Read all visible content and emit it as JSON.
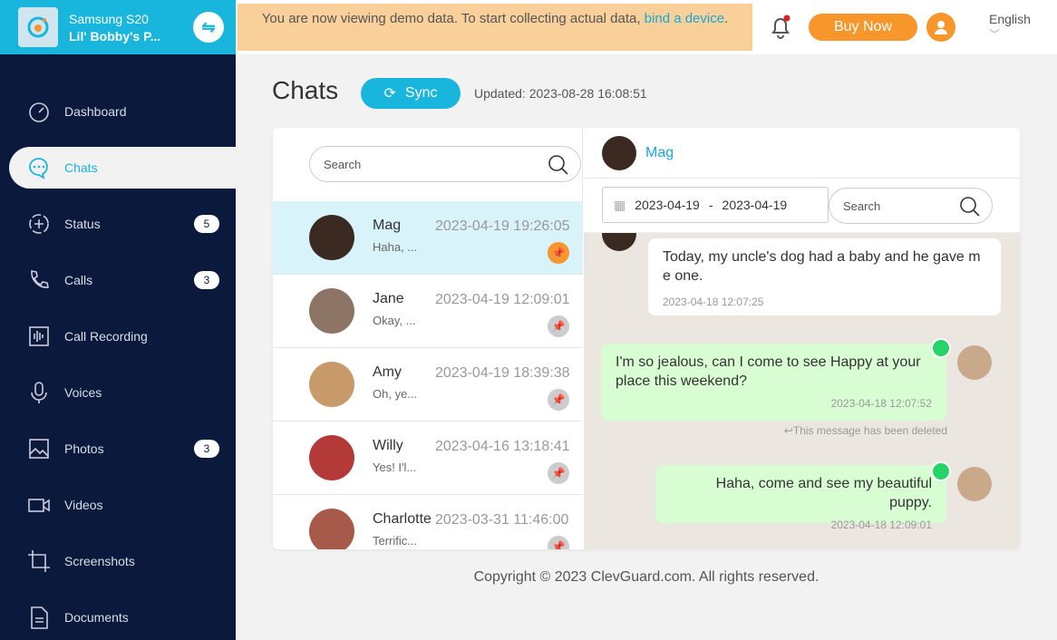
{
  "device": {
    "model": "Samsung S20",
    "user": "Lil' Bobby's P..."
  },
  "sidebar": {
    "items": [
      {
        "label": "Dashboard",
        "icon": "gauge-icon"
      },
      {
        "label": "Chats",
        "icon": "chat-bubble-icon",
        "active": true
      },
      {
        "label": "Status",
        "icon": "status-icon",
        "badge": "5"
      },
      {
        "label": "Calls",
        "icon": "phone-icon",
        "badge": "3"
      },
      {
        "label": "Call Recording",
        "icon": "waveform-icon"
      },
      {
        "label": "Voices",
        "icon": "microphone-icon"
      },
      {
        "label": "Photos",
        "icon": "image-icon",
        "badge": "3"
      },
      {
        "label": "Videos",
        "icon": "video-icon"
      },
      {
        "label": "Screenshots",
        "icon": "crop-icon"
      },
      {
        "label": "Documents",
        "icon": "document-icon"
      }
    ]
  },
  "banner": {
    "text": "You are now viewing demo data. To start collecting actual data, ",
    "link": "bind a device",
    "end": "."
  },
  "header": {
    "buy": "Buy Now",
    "language": "English"
  },
  "page": {
    "title": "Chats",
    "sync": "Sync",
    "updated": "Updated: 2023-08-28 16:08:51"
  },
  "list": {
    "search_placeholder": "Search",
    "items": [
      {
        "name": "Mag",
        "preview": "Haha, ...",
        "time": "2023-04-19 19:26:05",
        "color": "#3a2a22"
      },
      {
        "name": "Jane",
        "preview": "Okay, ...",
        "time": "2023-04-19 12:09:01",
        "color": "#8d7566"
      },
      {
        "name": "Amy",
        "preview": "Oh, ye...",
        "time": "2023-04-19 18:39:38",
        "color": "#c89a6a"
      },
      {
        "name": "Willy",
        "preview": "Yes! I'l...",
        "time": "2023-04-16 13:18:41",
        "color": "#b43a3a"
      },
      {
        "name": "Charlotte",
        "preview": "Terrific...",
        "time": "2023-03-31 11:46:00",
        "color": "#a85a4a"
      }
    ]
  },
  "chat": {
    "name": "Mag",
    "date_from": "2023-04-19",
    "date_sep": "-",
    "date_to": "2023-04-19",
    "search_placeholder": "Search",
    "messages": [
      {
        "text": "Today, my uncle's dog had a baby and he gave m e one.",
        "time": "2023-04-18 12:07:25"
      },
      {
        "text": "I'm so jealous, can I come to see Happy at your place this weekend?",
        "time": "2023-04-18 12:07:52"
      },
      {
        "text": "Haha, come and see my beautiful puppy.",
        "time": "2023-04-18 12:09:01"
      }
    ],
    "deleted": "This message has been deleted"
  },
  "footer": "Copyright © 2023 ClevGuard.com. All rights reserved.",
  "colors": {
    "accent": "#18b5dc",
    "sidebar": "#0b1a3c",
    "orange": "#f7962a",
    "outgoing": "#d9fdd3"
  }
}
